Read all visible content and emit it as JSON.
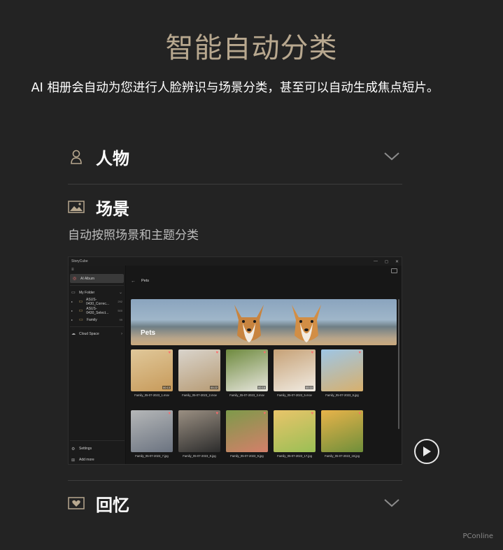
{
  "page": {
    "title": "智能自动分类",
    "subtitle": "AI 相册会自动为您进行人脸辨识与场景分类，甚至可以自动生成焦点短片。"
  },
  "sections": [
    {
      "id": "people",
      "label": "人物",
      "icon": "person-icon",
      "expanded": false
    },
    {
      "id": "scene",
      "label": "场景",
      "icon": "image-icon",
      "expanded": true,
      "description": "自动按照场景和主题分类"
    },
    {
      "id": "memories",
      "label": "回忆",
      "icon": "memory-icon",
      "expanded": false
    }
  ],
  "app": {
    "window_title": "StoryCube",
    "sidebar": {
      "ai_album": "AI Album",
      "my_folder": "My Folder",
      "folders": [
        {
          "name": "ASUS-0430_Correc...",
          "count": "292"
        },
        {
          "name": "ASUS-0430_Select...",
          "count": "500"
        },
        {
          "name": "Family",
          "count": "99"
        }
      ],
      "cloud_space": "Cloud Space",
      "settings": "Settings",
      "add_more": "Add more"
    },
    "breadcrumb": "Pets",
    "banner_label": "Pets",
    "thumbnails": [
      {
        "file": "Family_05-07-2023_1.mov",
        "duration": "00:13",
        "colors": [
          "#e0c89a",
          "#c79a5a"
        ]
      },
      {
        "file": "Family_05-07-2023_2.mov",
        "duration": "00:22",
        "colors": [
          "#d9d4cc",
          "#b79b74"
        ]
      },
      {
        "file": "Family_05-07-2023_3.mov",
        "duration": "00:16",
        "colors": [
          "#6e8a3e",
          "#e8e6de"
        ]
      },
      {
        "file": "Family_05-07-2023_5.mov",
        "duration": "00:10",
        "colors": [
          "#c6a176",
          "#f1ece3"
        ]
      },
      {
        "file": "Family_05-07-2023_6.jpg",
        "duration": "",
        "colors": [
          "#9ec6e6",
          "#d8b06c"
        ]
      },
      {
        "file": "Family_05-07-2023_7.jpg",
        "duration": "",
        "colors": [
          "#b5b7b8",
          "#6b7380"
        ]
      },
      {
        "file": "Family_05-07-2023_8.jpg",
        "duration": "",
        "colors": [
          "#9a8f82",
          "#2c2c2c"
        ]
      },
      {
        "file": "Family_05-07-2023_9.jpg",
        "duration": "",
        "colors": [
          "#7d9a4a",
          "#d47f6a"
        ]
      },
      {
        "file": "Family_05-07-2023_17.jpg",
        "duration": "",
        "colors": [
          "#e9c46a",
          "#9abf55"
        ]
      },
      {
        "file": "Family_05-07-2023_18.jpg",
        "duration": "",
        "colors": [
          "#e8b34a",
          "#6f8f3a"
        ]
      }
    ]
  },
  "watermark": "PConline",
  "colors": {
    "background": "#232323",
    "title_gold": "#b8a88f",
    "icon_gold": "#b8a88f",
    "heart": "#ff6b6b"
  }
}
